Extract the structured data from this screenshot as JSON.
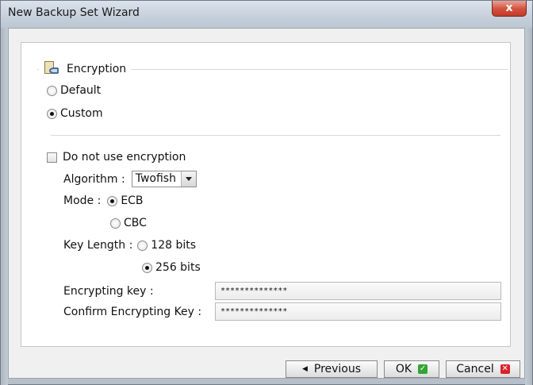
{
  "window": {
    "title": "New Backup Set Wizard",
    "close_glyph": "x"
  },
  "encryption": {
    "legend": "Encryption",
    "legend_icon": "document-key-icon",
    "default_label": "Default",
    "custom_label": "Custom",
    "selected_option": "Custom",
    "no_encryption_label": "Do not use encryption",
    "no_encryption_checked": false,
    "algorithm_label": "Algorithm :",
    "algorithm_value": "Twofish",
    "mode_label": "Mode :",
    "mode_ecb_label": "ECB",
    "mode_cbc_label": "CBC",
    "mode_selected": "ECB",
    "key_length_label": "Key Length :",
    "key_128_label": "128 bits",
    "key_256_label": "256 bits",
    "key_length_selected": "256 bits",
    "encrypting_key_label": "Encrypting key :",
    "encrypting_key_value": "**************",
    "confirm_key_label": "Confirm Encrypting Key :",
    "confirm_key_value": "**************"
  },
  "footer": {
    "previous_label": "Previous",
    "ok_label": "OK",
    "cancel_label": "Cancel"
  },
  "colors": {
    "ok_icon": "#33a534",
    "cancel_icon": "#d9232a",
    "close_button": "#c13b28"
  }
}
